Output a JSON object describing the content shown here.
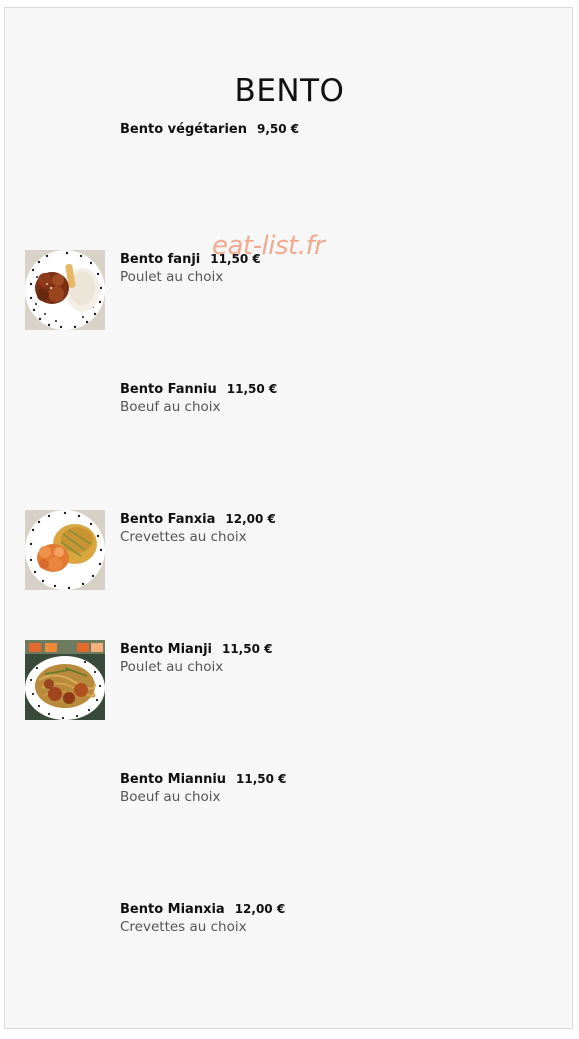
{
  "page": {
    "title": "BENTO",
    "watermark": "eat-list.fr"
  },
  "items": [
    {
      "name": "Bento végétarien",
      "price": "9,50 €",
      "description": ""
    },
    {
      "name": "Bento fanji",
      "price": "11,50 €",
      "description": "Poulet au choix"
    },
    {
      "name": "Bento Fanniu",
      "price": "11,50 €",
      "description": "Boeuf au choix"
    },
    {
      "name": "Bento Fanxia",
      "price": "12,00 €",
      "description": "Crevettes au choix"
    },
    {
      "name": "Bento Mianji",
      "price": "11,50 €",
      "description": "Poulet au choix"
    },
    {
      "name": "Bento Mianniu",
      "price": "11,50 €",
      "description": "Boeuf au choix"
    },
    {
      "name": "Bento Mianxia",
      "price": "12,00 €",
      "description": "Crevettes au choix"
    }
  ],
  "colors": {
    "background": "#f7f7f7",
    "text": "#111111",
    "description": "#555555",
    "watermark": "#f1a283"
  }
}
